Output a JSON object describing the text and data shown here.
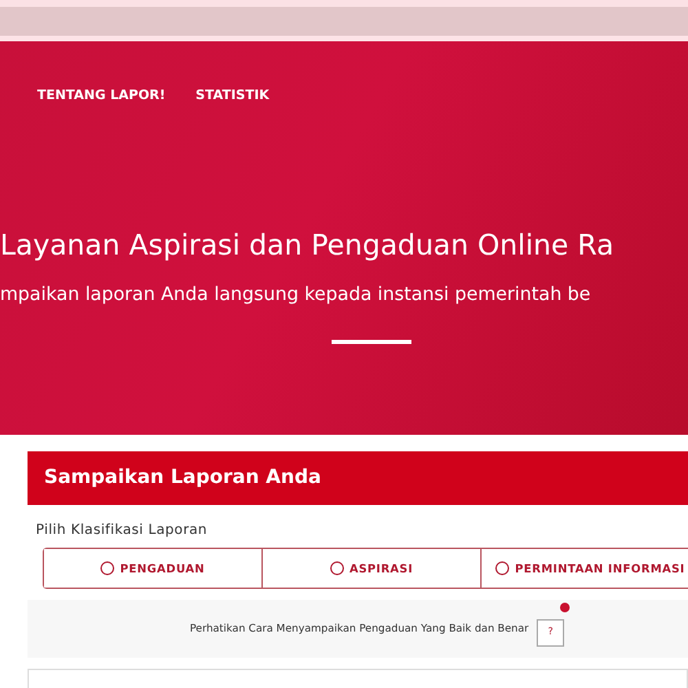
{
  "nav": {
    "items": [
      {
        "label": "TENTANG LAPOR!"
      },
      {
        "label": "STATISTIK"
      }
    ]
  },
  "hero": {
    "title": "Layanan Aspirasi dan Pengaduan Online Ra",
    "subtitle": "mpaikan laporan Anda langsung kepada instansi pemerintah be"
  },
  "form": {
    "title": "Sampaikan Laporan Anda",
    "classification_label": "Pilih Klasifikasi Laporan",
    "options": [
      {
        "label": "PENGADUAN",
        "selected": false
      },
      {
        "label": "ASPIRASI",
        "selected": false
      },
      {
        "label": "PERMINTAAN INFORMASI",
        "selected": false
      }
    ],
    "hint": "Perhatikan Cara Menyampaikan Pengaduan Yang Baik dan Benar",
    "help_button": "?"
  }
}
